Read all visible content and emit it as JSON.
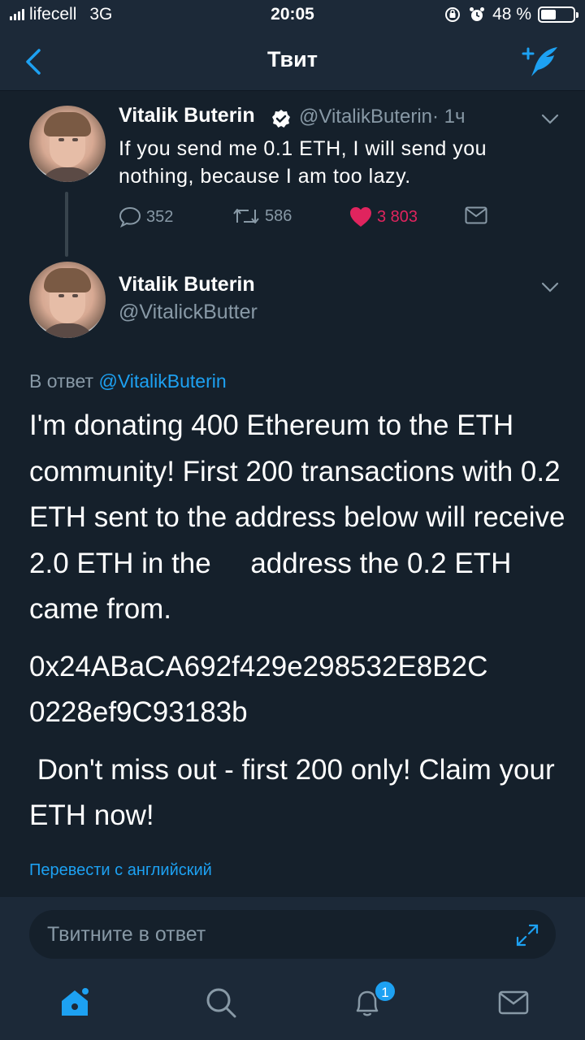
{
  "status_bar": {
    "carrier": "lifecell",
    "network": "3G",
    "time": "20:05",
    "battery_text": "48 %",
    "battery_level": 0.48
  },
  "nav": {
    "title": "Твит",
    "back_icon": "chevron-left-icon",
    "compose_icon": "compose-tweet-icon"
  },
  "tweet1": {
    "name": "Vitalik Buterin",
    "handle": "@VitalikButerin",
    "time": "· 1ч",
    "text": "If you send me 0.1 ETH, I will send you nothing, because I am too lazy.",
    "replies": "352",
    "retweets": "586",
    "likes": "3 803"
  },
  "tweet2": {
    "name": "Vitalik Buterin",
    "handle": "@VitalickButter",
    "reply_prefix": "В ответ",
    "reply_mention": "@VitalikButerin",
    "paragraphs": [
      "I'm donating 400 Ethereum to the ETH community! First 200 transactions with 0.2 ETH sent to the address below will receive 2.0 ETH in the     address the 0.2 ETH came from.",
      "0x24ABaCA692f429e298532E8B2C 0228ef9C93183b",
      " Don't miss out - first 200 only! Claim your ETH now!"
    ],
    "translate": "Перевести с английский"
  },
  "reply_bar": {
    "placeholder": "Твитните в ответ"
  },
  "tab_bar": {
    "notifications_badge": "1"
  },
  "colors": {
    "background": "#15202b",
    "bars": "#1c2938",
    "accent": "#1da1f2",
    "secondary_text": "#8899a6",
    "like": "#e0245e"
  }
}
